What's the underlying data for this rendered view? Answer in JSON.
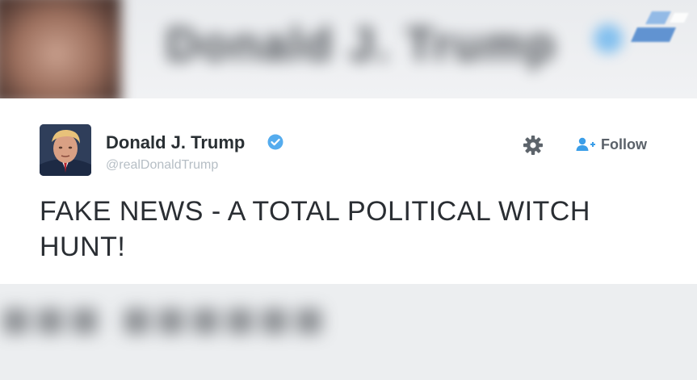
{
  "tweet": {
    "display_name": "Donald J. Trump",
    "handle": "@realDonaldTrump",
    "text": "FAKE NEWS - A TOTAL POLITICAL WITCH HUNT!",
    "follow_label": "Follow"
  },
  "icons": {
    "verified": "verified-badge-icon",
    "settings": "gear-icon",
    "follow": "add-user-icon"
  },
  "colors": {
    "verified_blue": "#55acee",
    "follow_blue": "#3b9ee8",
    "text_dark": "#292f33",
    "handle_gray": "#b6bec5"
  }
}
